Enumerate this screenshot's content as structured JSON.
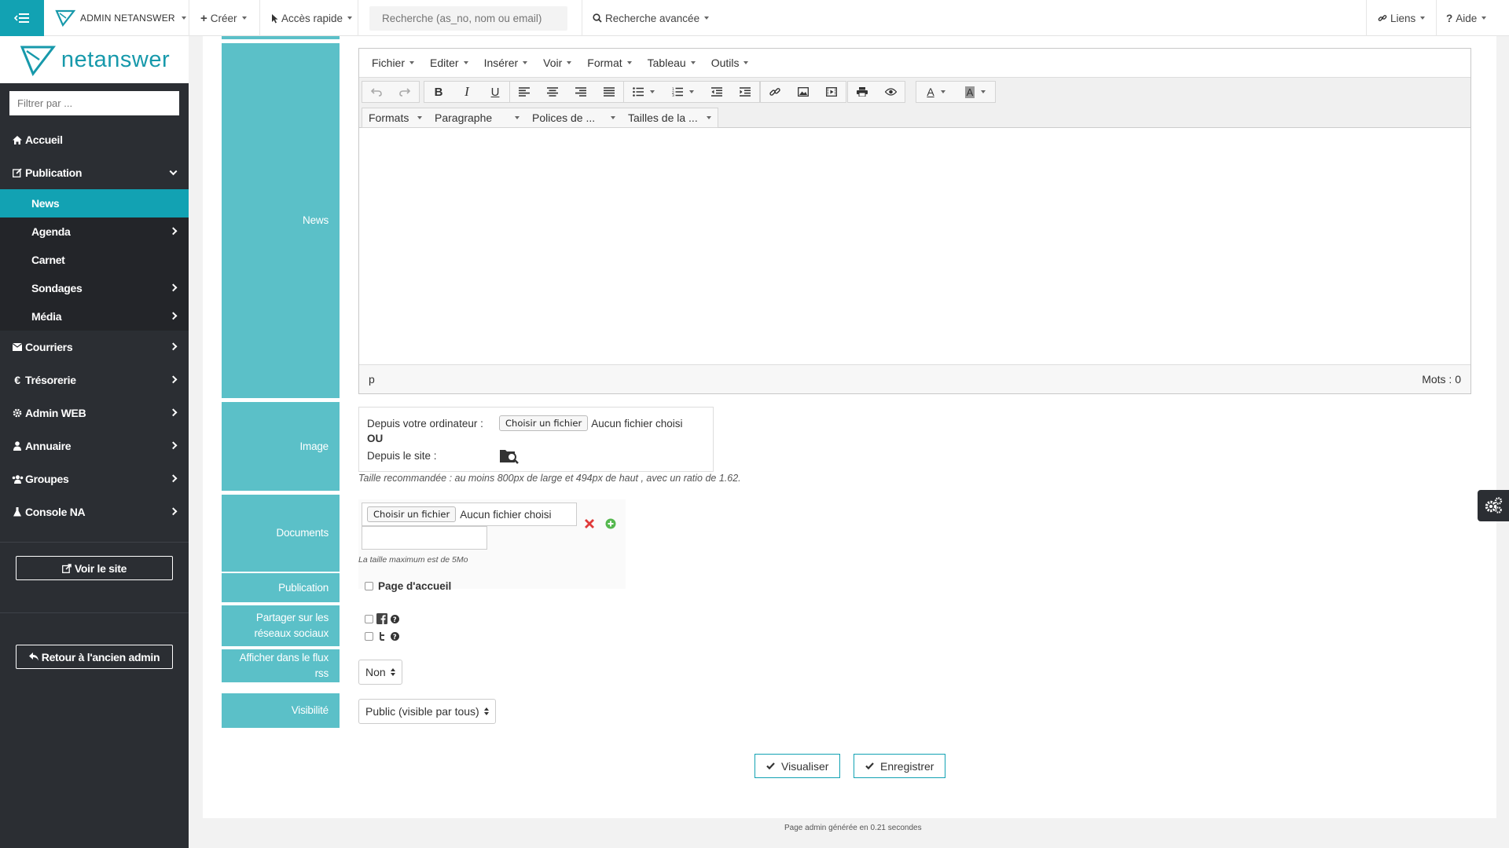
{
  "topbar": {
    "app_name": "ADMIN NETANSWER",
    "create": "Créer",
    "quick_access": "Accès rapide",
    "search_placeholder": "Recherche (as_no, nom ou email)",
    "advanced_search": "Recherche avancée",
    "links": "Liens",
    "help": "Aide"
  },
  "sidebar": {
    "logo": "netanswer",
    "filter_placeholder": "Filtrer par ...",
    "items": [
      {
        "label": "Accueil",
        "icon": "home-icon"
      },
      {
        "label": "Publication",
        "icon": "edit-icon"
      },
      {
        "label": "Courriers",
        "icon": "envelope-icon"
      },
      {
        "label": "Trésorerie",
        "icon": "euro-icon"
      },
      {
        "label": "Admin WEB",
        "icon": "gear-icon"
      },
      {
        "label": "Annuaire",
        "icon": "user-icon"
      },
      {
        "label": "Groupes",
        "icon": "users-icon"
      },
      {
        "label": "Console NA",
        "icon": "flask-icon"
      }
    ],
    "subitems": [
      "News",
      "Agenda",
      "Carnet",
      "Sondages",
      "Média"
    ],
    "view_site": "Voir le site",
    "back_old_admin": "Retour à l'ancien admin"
  },
  "form": {
    "labels": {
      "news": "News",
      "image": "Image",
      "documents": "Documents",
      "publication": "Publication",
      "share": "Partager sur les réseaux sociaux",
      "rss": "Afficher dans le flux rss",
      "visibility": "Visibilité"
    },
    "editor": {
      "menus": [
        "Fichier",
        "Editer",
        "Insérer",
        "Voir",
        "Format",
        "Tableau",
        "Outils"
      ],
      "formats": "Formats",
      "paragraph": "Paragraphe",
      "fonts": "Polices de ...",
      "sizes": "Tailles de la ...",
      "path": "p",
      "wordcount": "Mots : 0"
    },
    "image": {
      "from_computer": "Depuis votre ordinateur :",
      "choose_file": "Choisir un fichier",
      "no_file": "Aucun fichier choisi",
      "or": "OU",
      "from_site": "Depuis le site :",
      "hint": "Taille recommandée : au moins 800px de large et 494px de haut , avec un ratio de 1.62."
    },
    "documents": {
      "choose_file": "Choisir un fichier",
      "no_file": "Aucun fichier choisi",
      "max_size": "La taille maximum est de 5Mo"
    },
    "publication": {
      "home_page": "Page d'accueil"
    },
    "rss_value": "Non",
    "visibility_value": "Public (visible par tous)",
    "preview_button": "Visualiser",
    "save_button": "Enregistrer"
  },
  "footer": "Page admin générée en 0.21 secondes",
  "colors": {
    "accent": "#12a2b3",
    "label_bg": "#5bc0c8",
    "sidebar_bg": "#2b2e33"
  }
}
